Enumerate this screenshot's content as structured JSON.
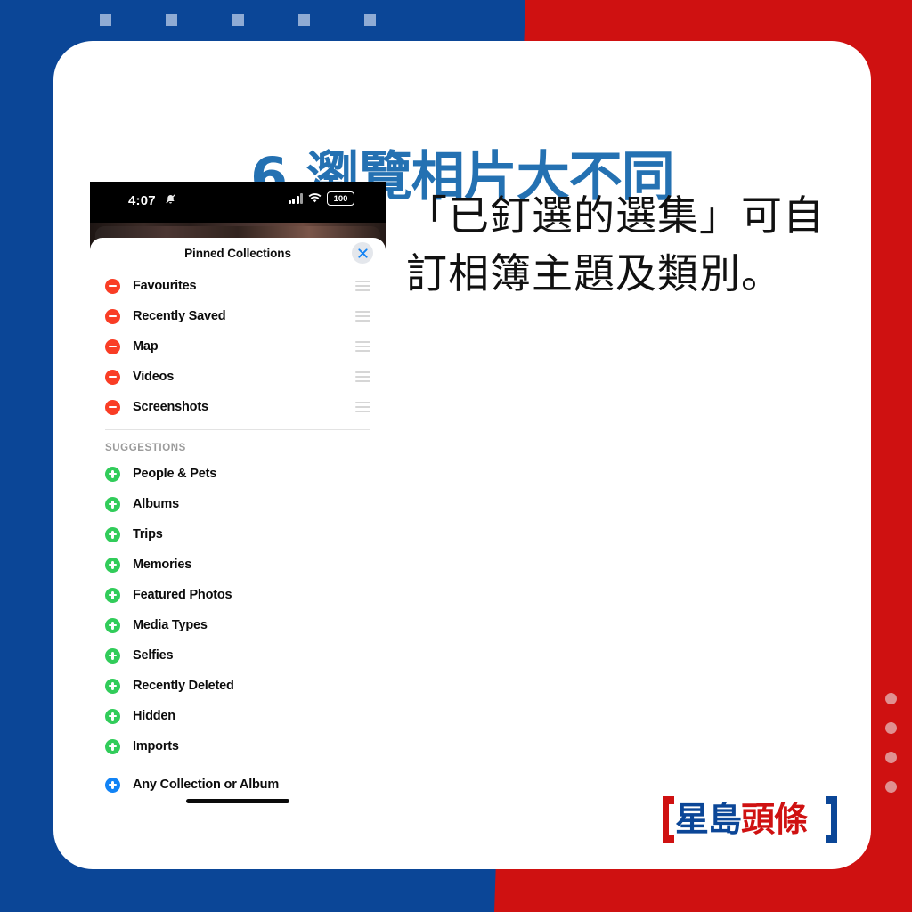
{
  "background": {
    "blue": "#0b4697",
    "red": "#cf1111",
    "top_dash_count": 5,
    "side_dot_count": 4
  },
  "card": {
    "headline": "6.瀏覽相片大不同",
    "headline_color": "#2471b2",
    "caption": "「已釘選的選集」可自訂相簿主題及類別。"
  },
  "phone": {
    "status_bar": {
      "time": "4:07",
      "mute_icon": "mute-bell-icon",
      "signal_icon": "cellular-bars-icon",
      "wifi_icon": "wifi-icon",
      "battery_level": "100"
    },
    "sheet": {
      "title": "Pinned Collections",
      "close_icon": "close-icon",
      "pinned": [
        {
          "label": "Favourites",
          "action": "remove"
        },
        {
          "label": "Recently Saved",
          "action": "remove"
        },
        {
          "label": "Map",
          "action": "remove"
        },
        {
          "label": "Videos",
          "action": "remove"
        },
        {
          "label": "Screenshots",
          "action": "remove"
        }
      ],
      "section_label": "SUGGESTIONS",
      "suggestions": [
        {
          "label": "People & Pets",
          "action": "add"
        },
        {
          "label": "Albums",
          "action": "add"
        },
        {
          "label": "Trips",
          "action": "add"
        },
        {
          "label": "Memories",
          "action": "add"
        },
        {
          "label": "Featured Photos",
          "action": "add"
        },
        {
          "label": "Media Types",
          "action": "add"
        },
        {
          "label": "Selfies",
          "action": "add"
        },
        {
          "label": "Recently Deleted",
          "action": "add"
        },
        {
          "label": "Hidden",
          "action": "add"
        },
        {
          "label": "Imports",
          "action": "add"
        }
      ],
      "footer": {
        "label": "Any Collection or Album",
        "action": "add-blue"
      },
      "colors": {
        "remove_badge": "#f93d25",
        "add_badge": "#31cc5a",
        "add_blue_badge": "#1283f5",
        "close_glyph": "#1283f5"
      }
    }
  },
  "logo": {
    "text_blue": "星島",
    "text_red": "頭條"
  }
}
